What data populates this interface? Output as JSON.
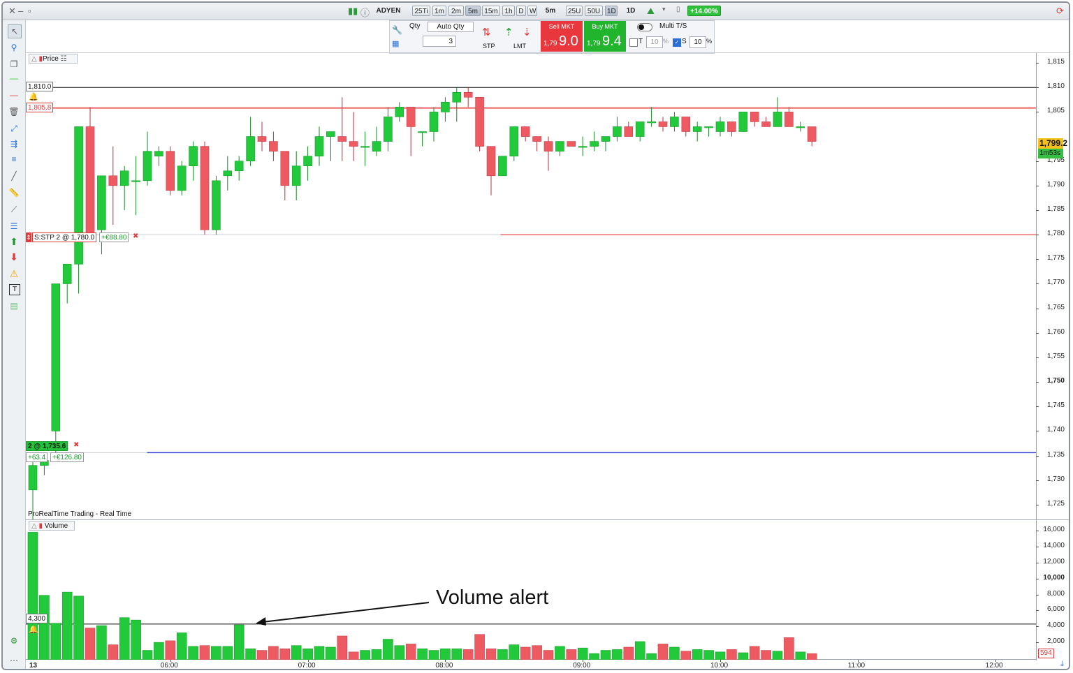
{
  "toolbar": {
    "symbol": "ADYEN",
    "timeframes": [
      "25Ti",
      "1m",
      "2m",
      "5m",
      "15m",
      "1h",
      "D",
      "W"
    ],
    "selected_timeframe": "5m",
    "units": [
      "25U",
      "50U",
      "1D"
    ],
    "period": "1D",
    "change": "+14.00%"
  },
  "order": {
    "qty_label": "Qty",
    "auto_qty_label": "Auto Qty",
    "qty_value": "3",
    "stp_label": "STP",
    "lmt_label": "LMT",
    "sell_label": "Sell MKT",
    "sell_prefix": "1,79",
    "sell_value": "9.0",
    "buy_label": "Buy MKT",
    "buy_prefix": "1,79",
    "buy_value": "9.4",
    "multi_label": "Multi T/S",
    "t_label": "T",
    "t_value": "10",
    "t_pct": "%",
    "s_label": "S",
    "s_value": "10",
    "s_pct": "%"
  },
  "price_panel": {
    "tag": "Price",
    "alert_level": "1,810.0",
    "order_level": "1,805.8",
    "stop_order": "S:STP 2 @ 1,780.0",
    "stop_pnl": "+€88.80",
    "position": "2 @ 1,735.6",
    "position_points": "+63.4",
    "position_pnl": "+€126.80",
    "current_price": "1,799.2",
    "countdown": "1m53s",
    "footer": "ProRealTime Trading - Real Time",
    "y_ticks": [
      "1,815",
      "1,810",
      "1,805",
      "1,795",
      "1,790",
      "1,785",
      "1,780",
      "1,775",
      "1,770",
      "1,765",
      "1,760",
      "1,755",
      "1,750",
      "1,745",
      "1,740",
      "1,735",
      "1,730",
      "1,725"
    ]
  },
  "volume_panel": {
    "tag": "Volume",
    "alert_level": "4,300",
    "last_volume": "594",
    "y_ticks": [
      "16,000",
      "14,000",
      "12,000",
      "10,000",
      "8,000",
      "6,000",
      "4,000",
      "2,000"
    ]
  },
  "x_axis": {
    "day": "13",
    "ticks": [
      "06:00",
      "07:00",
      "08:00",
      "09:00",
      "10:00",
      "11:00",
      "12:00"
    ]
  },
  "annotation": "Volume alert",
  "colors": {
    "up": "#22c93a",
    "down": "#ee5a62",
    "alert": "#111111",
    "order": "#e8343a",
    "position": "#3a3fd6"
  },
  "chart_data": {
    "type": "candlestick",
    "interval": "5m",
    "candles": [
      [
        1728,
        1735,
        1722,
        1733
      ],
      [
        1733,
        1735,
        1731,
        1734
      ],
      [
        1740,
        1770,
        1735,
        1770
      ],
      [
        1770,
        1774,
        1766,
        1774
      ],
      [
        1774,
        1782,
        1768,
        1802
      ],
      [
        1802,
        1806,
        1781,
        1780
      ],
      [
        1781,
        1786,
        1776,
        1792
      ],
      [
        1792,
        1798,
        1782,
        1790
      ],
      [
        1790,
        1794,
        1785,
        1793
      ],
      [
        1791,
        1796,
        1784,
        1791
      ],
      [
        1791,
        1801,
        1790,
        1797
      ],
      [
        1796,
        1798,
        1794,
        1797
      ],
      [
        1797,
        1798,
        1788,
        1789
      ],
      [
        1789,
        1795,
        1788,
        1794
      ],
      [
        1794,
        1799,
        1791,
        1798
      ],
      [
        1798,
        1799,
        1780,
        1781
      ],
      [
        1781,
        1792,
        1780,
        1791
      ],
      [
        1792,
        1796,
        1789,
        1793
      ],
      [
        1793,
        1796,
        1791,
        1795
      ],
      [
        1795,
        1804,
        1794,
        1800
      ],
      [
        1800,
        1803,
        1797,
        1799
      ],
      [
        1799,
        1801,
        1795,
        1797
      ],
      [
        1797,
        1797,
        1787,
        1790
      ],
      [
        1790,
        1797,
        1787,
        1794
      ],
      [
        1794,
        1798,
        1791,
        1796
      ],
      [
        1796,
        1802,
        1794,
        1800
      ],
      [
        1800,
        1801,
        1795,
        1801
      ],
      [
        1800,
        1808,
        1795,
        1799
      ],
      [
        1799,
        1805,
        1795,
        1798
      ],
      [
        1798,
        1801,
        1794,
        1798
      ],
      [
        1797,
        1802,
        1796,
        1799
      ],
      [
        1799,
        1806,
        1797,
        1804
      ],
      [
        1804,
        1807,
        1803,
        1806
      ],
      [
        1806,
        1806,
        1796,
        1802
      ],
      [
        1801,
        1801,
        1798,
        1801
      ],
      [
        1801,
        1806,
        1799,
        1805
      ],
      [
        1805,
        1808,
        1803,
        1807
      ],
      [
        1807,
        1810,
        1803,
        1809
      ],
      [
        1809,
        1810,
        1806,
        1808
      ],
      [
        1808,
        1808,
        1797,
        1798
      ],
      [
        1798,
        1798,
        1788,
        1792
      ],
      [
        1792,
        1796,
        1792,
        1796
      ],
      [
        1796,
        1802,
        1795,
        1802
      ],
      [
        1802,
        1802,
        1799,
        1800
      ],
      [
        1800,
        1800,
        1797,
        1799
      ],
      [
        1799,
        1800,
        1793,
        1797
      ],
      [
        1797,
        1799,
        1796,
        1799
      ],
      [
        1799,
        1799,
        1798,
        1798
      ],
      [
        1798,
        1800,
        1796,
        1798
      ],
      [
        1798,
        1801,
        1797,
        1799
      ],
      [
        1799,
        1800,
        1797,
        1800
      ],
      [
        1800,
        1804,
        1799,
        1802
      ],
      [
        1802,
        1803,
        1800,
        1800
      ],
      [
        1800,
        1803,
        1799,
        1803
      ],
      [
        1803,
        1806,
        1802,
        1803
      ],
      [
        1803,
        1804,
        1801,
        1802
      ],
      [
        1802,
        1805,
        1801,
        1804
      ],
      [
        1804,
        1804,
        1800,
        1801
      ],
      [
        1801,
        1803,
        1799,
        1802
      ],
      [
        1802,
        1802,
        1800,
        1802
      ],
      [
        1801,
        1804,
        1800,
        1803
      ],
      [
        1803,
        1803,
        1800,
        1801
      ],
      [
        1801,
        1805,
        1801,
        1805
      ],
      [
        1805,
        1805,
        1802,
        1803
      ],
      [
        1803,
        1804,
        1802,
        1802
      ],
      [
        1802,
        1808,
        1802,
        1805
      ],
      [
        1805,
        1806,
        1802,
        1802
      ],
      [
        1802,
        1803,
        1801,
        1802
      ],
      [
        1802,
        1802,
        1798,
        1799
      ]
    ],
    "volumes": [
      15800,
      7900,
      4400,
      8300,
      7800,
      3800,
      4100,
      1700,
      5100,
      4800,
      1000,
      2000,
      2200,
      3200,
      1500,
      1600,
      1500,
      1500,
      4200,
      1200,
      1000,
      1500,
      1200,
      1600,
      1200,
      1500,
      1400,
      2800,
      800,
      1000,
      1100,
      2400,
      1600,
      1800,
      1200,
      1000,
      1200,
      1200,
      1100,
      3000,
      1200,
      1100,
      1700,
      1400,
      1600,
      1000,
      1500,
      1100,
      1300,
      600,
      1000,
      1100,
      1400,
      2100,
      600,
      1800,
      1400,
      900,
      1100,
      1000,
      800,
      1100,
      700,
      1500,
      1000,
      900,
      2600,
      800,
      594
    ],
    "ylim_price": [
      1722,
      1817
    ],
    "ylim_volume": [
      0,
      16800
    ],
    "alerts": {
      "price": 1810.0,
      "volume": 4300
    }
  }
}
